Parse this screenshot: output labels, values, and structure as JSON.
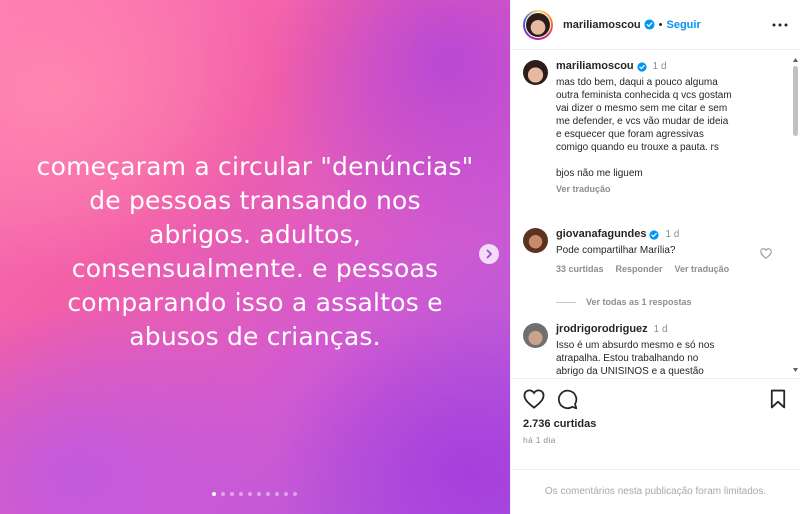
{
  "post": {
    "author": "mariliamoscou",
    "follow_label": "Seguir",
    "header_separator": "•",
    "slide_text": "começaram a circular \"denúncias\"\nde pessoas transando nos\nabrigos. adultos,\nconsensualmente. e pessoas\ncomparando isso a assaltos e\nabusos de crianças.",
    "slide_count": 10,
    "active_slide": 1,
    "caption": {
      "author": "mariliamoscou",
      "time": "1 d",
      "text": "mas tdo bem, daqui a pouco alguma\noutra feminista conhecida q vcs gostam\nvai dizer o mesmo sem me citar e sem\nme defender, e vcs vão mudar de ideia\ne esquecer que foram agressivas\ncomigo quando eu trouxe a pauta. rs\n\nbjos não me liguem",
      "translate": "Ver tradução"
    },
    "comments": [
      {
        "author": "giovanafagundes",
        "time": "1 d",
        "text": "Pode compartilhar Marília?",
        "likes": "33 curtidas",
        "reply": "Responder",
        "translate": "Ver tradução",
        "view_replies": "Ver todas as 1 respostas"
      },
      {
        "author": "jrodrigorodriguez",
        "time": "1 d",
        "text": "Isso é um absurdo mesmo e só nos\natrapalha. Estou trabalhando no\nabrigo da UNISINOS e a questão"
      }
    ],
    "likes_count": "2.736 curtidas",
    "posted_ago": "há 1 dia",
    "comments_limited": "Os comentários nesta publicação foram limitados.",
    "colors": {
      "accent": "#0095f6",
      "verified": "#0095f6",
      "muted": "#8e8e8e"
    }
  }
}
